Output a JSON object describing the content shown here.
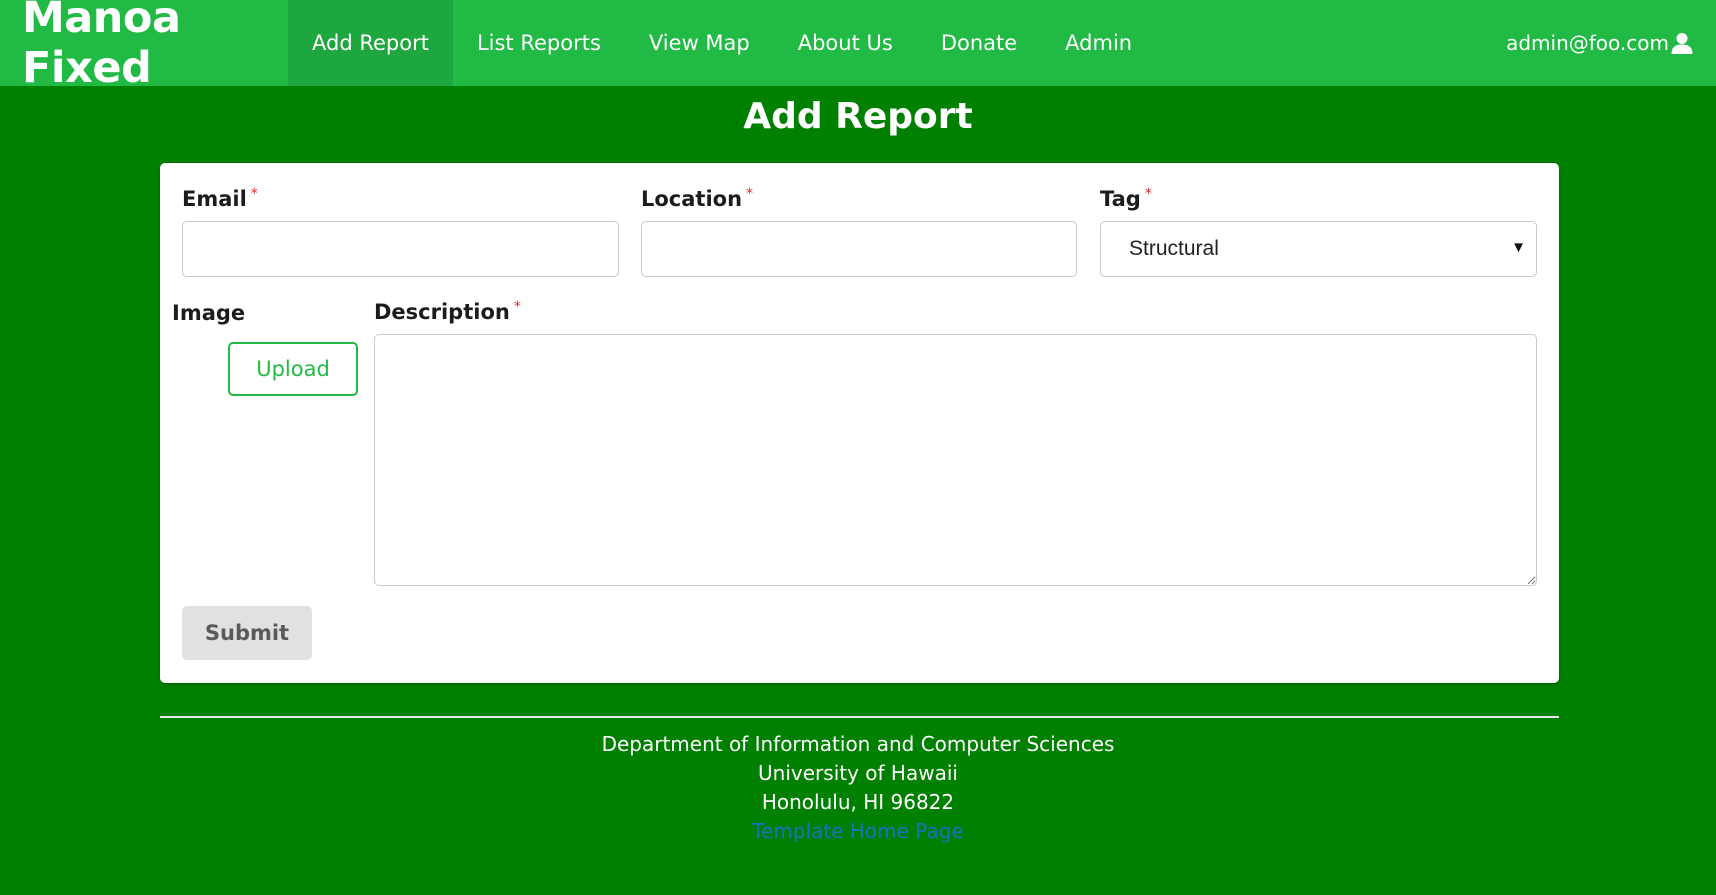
{
  "navbar": {
    "brand": "Manoa Fixed",
    "items": [
      {
        "label": "Add Report",
        "active": true
      },
      {
        "label": "List Reports"
      },
      {
        "label": "View Map"
      },
      {
        "label": "About Us"
      },
      {
        "label": "Donate"
      },
      {
        "label": "Admin"
      }
    ],
    "user": "admin@foo.com",
    "user_icon": "user-icon"
  },
  "page": {
    "title": "Add Report"
  },
  "form": {
    "email_label": "Email",
    "location_label": "Location",
    "tag_label": "Tag",
    "tag_value": "Structural",
    "image_label": "Image",
    "upload_label": "Upload",
    "description_label": "Description",
    "required_marker": "*",
    "submit_label": "Submit",
    "email_value": "",
    "location_value": "",
    "description_value": ""
  },
  "footer": {
    "line1": "Department of Information and Computer Sciences",
    "line2": "University of Hawaii",
    "line3": "Honolulu, HI 96822",
    "link": "Template Home Page"
  },
  "colors": {
    "page_background": "#008000",
    "navbar": "#21ba45",
    "navbar_active": "#1ea73e",
    "required": "#db2828",
    "link": "#1e70bf"
  }
}
